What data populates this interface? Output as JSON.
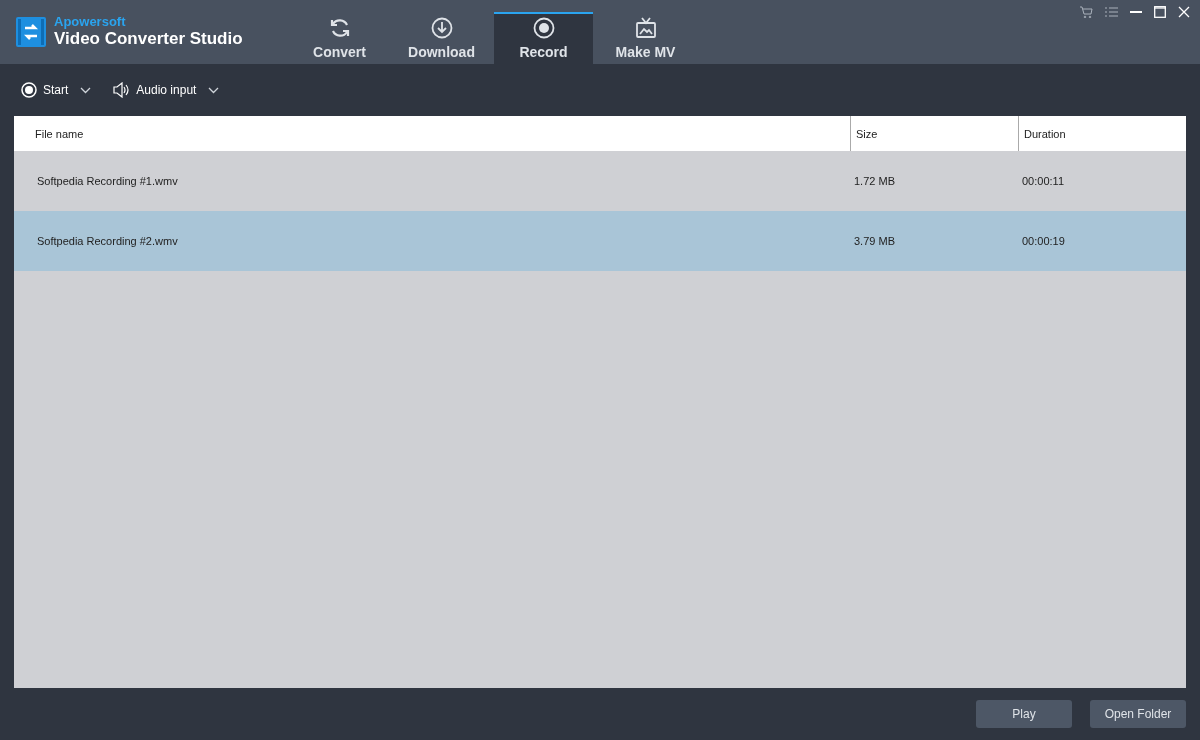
{
  "app": {
    "brand": "Apowersoft",
    "title": "Video Converter Studio"
  },
  "tabs": [
    {
      "label": "Convert",
      "kind": "convert",
      "selected": false
    },
    {
      "label": "Download",
      "kind": "download",
      "selected": false
    },
    {
      "label": "Record",
      "kind": "record",
      "selected": true
    },
    {
      "label": "Make MV",
      "kind": "tv",
      "selected": false
    }
  ],
  "toolbar": [
    {
      "label": "Start",
      "kind": "record"
    },
    {
      "label": "Audio input",
      "kind": "speaker"
    }
  ],
  "table": {
    "columns": [
      "File name",
      "Size",
      "Duration"
    ],
    "rows": [
      {
        "cells": [
          "Softpedia Recording #1.wmv",
          "1.72 MB",
          "00:00:11"
        ],
        "selected": false
      },
      {
        "cells": [
          "Softpedia Recording #2.wmv",
          "3.79 MB",
          "00:00:19"
        ],
        "selected": true
      }
    ]
  },
  "buttons": [
    "Play",
    "Open Folder"
  ]
}
